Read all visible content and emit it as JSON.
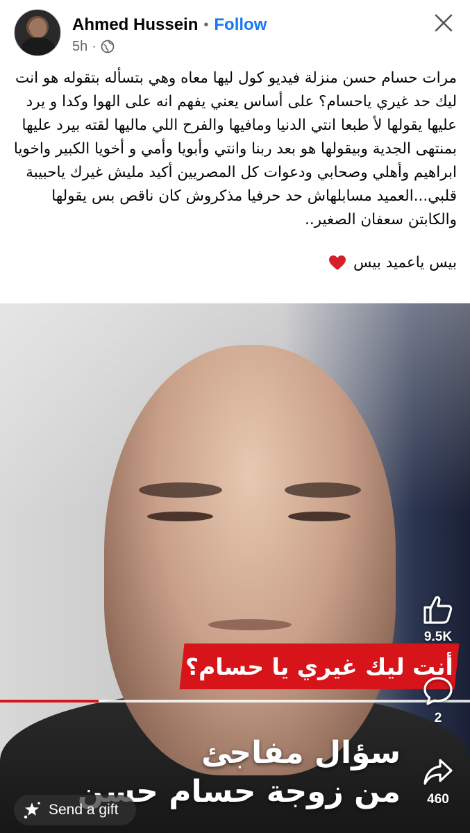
{
  "post": {
    "author": "Ahmed Hussein",
    "separator": "•",
    "follow_label": "Follow",
    "time": "5h",
    "audience_icon": "globe-icon",
    "text": "مرات حسام حسن منزلة فيديو كول ليها معاه وهي بتسأله بتقوله هو انت ليك حد غيري ياحسام؟ على أساس يعني يفهم انه على الهوا وكدا و يرد عليها يقولها لأ طبعا انتي الدنيا ومافيها والفرح اللي ماليها لقته بيرد عليها بمنتهى الجدية وبيقولها هو بعد ربنا وانتي وأبويا وأمي و أخويا الكبير واخويا ابراهيم وأهلي وصحابي ودعوات كل المصريين أكيد مليش غيرك ياحبيبة قلبي...العميد مسابلهاش حد حرفيا مذكروش كان ناقص بس يقولها والكابتن سعفان الصغير..",
    "signoff": "بيس ياعميد بيس",
    "heart_color": "#d61f26"
  },
  "video": {
    "banner_text": "أنت ليك غيري يا حسام؟",
    "caption_line1": "سؤال مفاجئ",
    "caption_line2": "من زوجة حسام حسن",
    "progress": 0.21,
    "likes": "9.5K",
    "comments": "2",
    "shares": "460",
    "gift_label": "Send a gift",
    "accent": "#d7141a"
  }
}
